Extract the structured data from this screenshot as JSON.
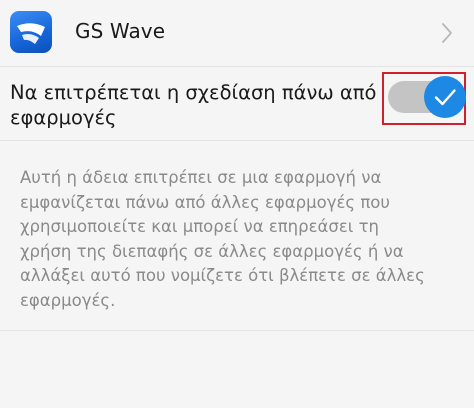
{
  "app": {
    "name": "GS Wave",
    "icon": "gs-wave-app-icon",
    "accent": "#1e88e5"
  },
  "permission": {
    "label_lines": [
      "Να επιτρέπεται η σχεδίαση πάνω από",
      "εφαρμογές"
    ],
    "enabled": true,
    "switch_on_color": "#1e88e5",
    "highlight_color": "#d0202e"
  },
  "description": {
    "lines": [
      "Αυτή η άδεια επιτρέπει σε μια εφαρμογή να",
      "εμφανίζεται πάνω από άλλες εφαρμογές που",
      "χρησιμοποιείτε και μπορεί να επηρεάσει τη",
      "χρήση της διεπαφής σε άλλες εφαρμογές ή να",
      "αλλάξει αυτό που νομίζετε ότι βλέπετε σε άλλες",
      "εφαρμογές."
    ]
  }
}
